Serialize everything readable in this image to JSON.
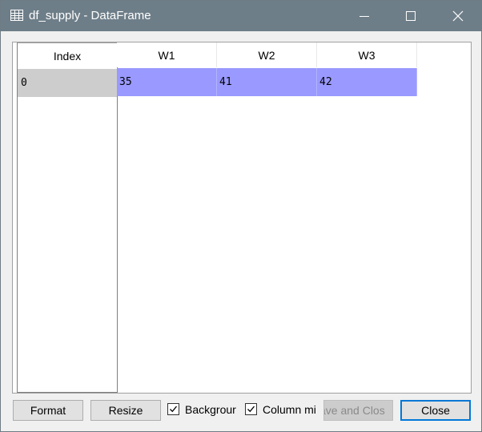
{
  "window": {
    "title": "df_supply - DataFrame",
    "title_icon": "table-icon"
  },
  "table": {
    "index_header": "Index",
    "columns": [
      "W1",
      "W2",
      "W3"
    ],
    "index_values": [
      "0"
    ],
    "rows": [
      [
        "35",
        "41",
        "42"
      ]
    ],
    "header_bg": "#ffffff",
    "cell_bg": "#9999ff",
    "index_cell_bg": "#cdcdcd"
  },
  "buttons": {
    "format": "Format",
    "resize": "Resize",
    "save_and_close": "ave and Clos",
    "close": "Close"
  },
  "checkboxes": {
    "background": {
      "label": "Backgrour",
      "checked": true
    },
    "column_min": {
      "label": "Column mi",
      "checked": true
    }
  },
  "colors": {
    "titlebar": "#6e7e89",
    "accent": "#0078d7"
  }
}
